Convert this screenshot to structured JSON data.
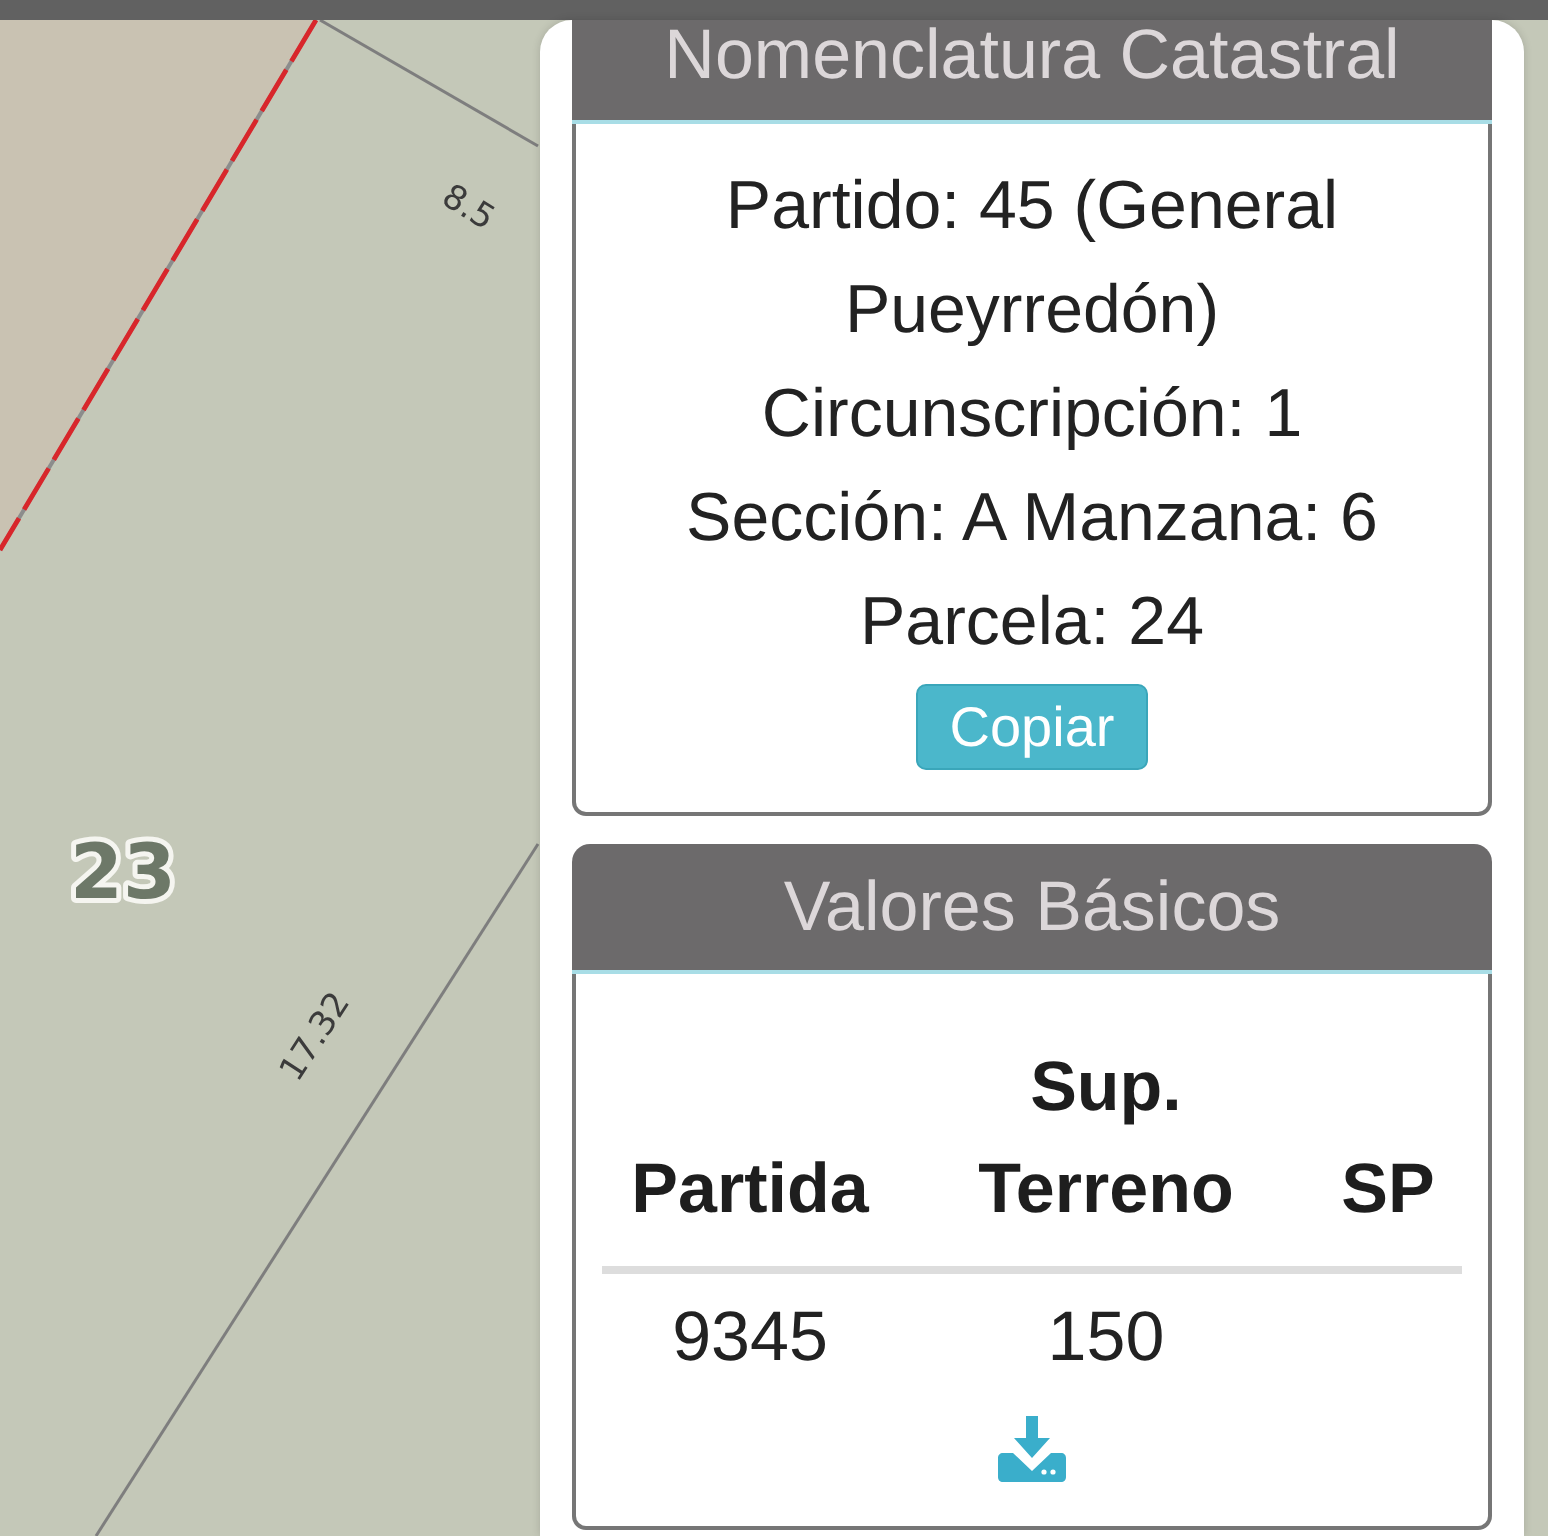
{
  "map": {
    "measurements": [
      {
        "text": "8.5"
      },
      {
        "text": "17.32"
      }
    ],
    "parcel_number": "23"
  },
  "panels": [
    {
      "kind": "text",
      "title": "Nomenclatura Catastral",
      "lines": [
        "Partido: 45 (General Pueyrredón)",
        "Circunscripción: 1",
        "Sección: A Manzana: 6",
        "Parcela: 24"
      ],
      "button": "Copiar"
    },
    {
      "kind": "table",
      "title": "Valores Básicos",
      "columns": [
        "Partida",
        "Sup. Terreno",
        "SP"
      ],
      "rows": [
        {
          "cells": [
            "9345",
            "150"
          ]
        }
      ]
    }
  ]
}
